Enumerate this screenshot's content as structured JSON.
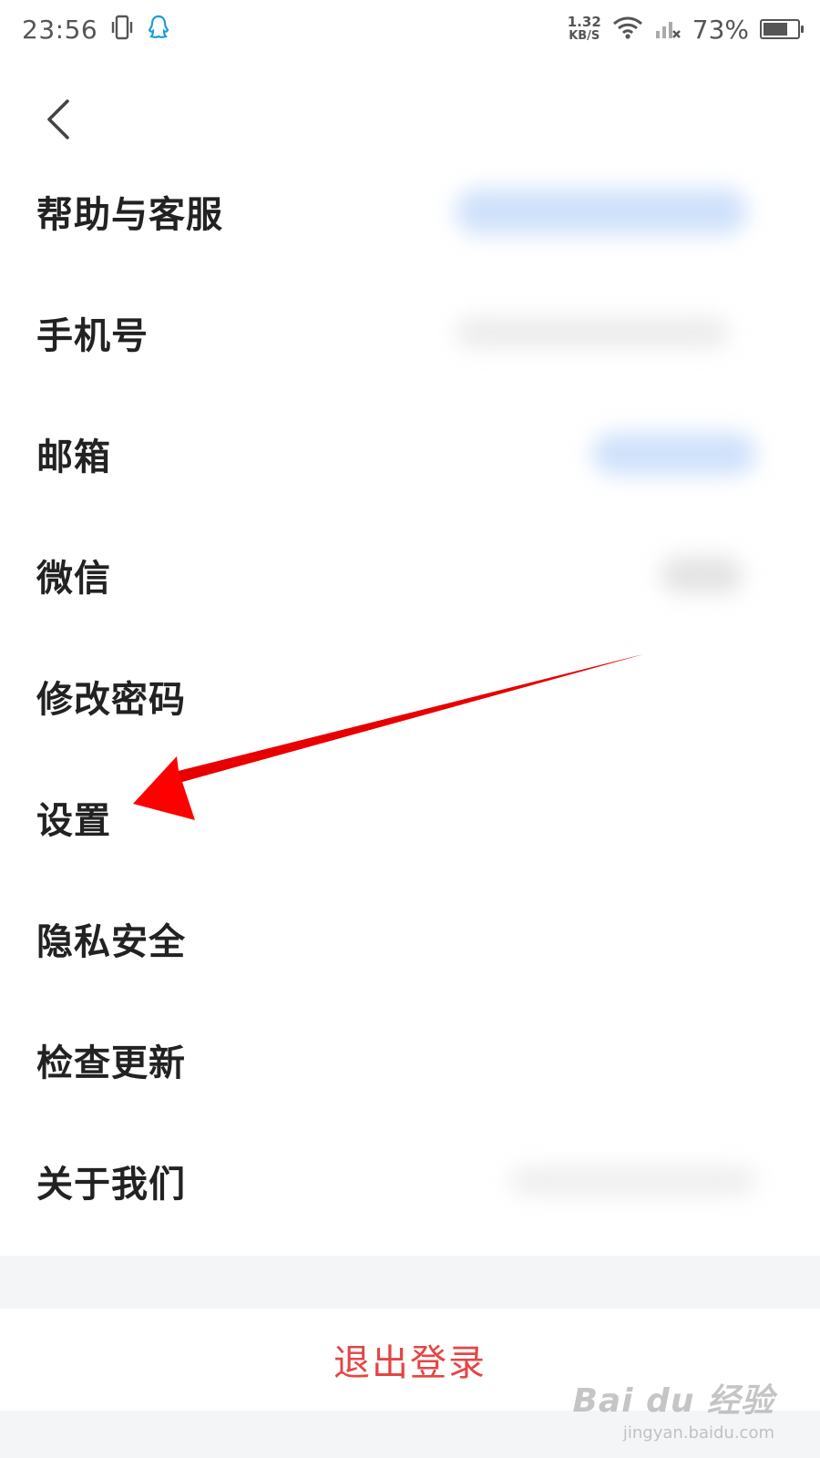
{
  "status_bar": {
    "time": "23:56",
    "net_speed_value": "1.32",
    "net_speed_unit": "KB/S",
    "battery_percent": "73%",
    "battery_level": 0.73,
    "icons": [
      "vibrate-icon",
      "qq-icon",
      "wifi-icon",
      "signal-icon",
      "battery-icon"
    ]
  },
  "nav": {
    "back_icon": "chevron-left-icon"
  },
  "menu": {
    "items": [
      {
        "label": "帮助与客服"
      },
      {
        "label": "手机号"
      },
      {
        "label": "邮箱"
      },
      {
        "label": "微信"
      },
      {
        "label": "修改密码"
      },
      {
        "label": "设置"
      },
      {
        "label": "隐私安全"
      },
      {
        "label": "检查更新"
      },
      {
        "label": "关于我们"
      }
    ]
  },
  "logout": {
    "label": "退出登录"
  },
  "watermark": {
    "logo": "Bai du 经验",
    "url": "jingyan.baidu.com"
  },
  "colors": {
    "logout_text": "#e54545",
    "arrow": "#ff0000",
    "blur_blue": "#cfe1fb",
    "blur_gray": "#e3e3e3",
    "band": "#f4f5f7"
  }
}
